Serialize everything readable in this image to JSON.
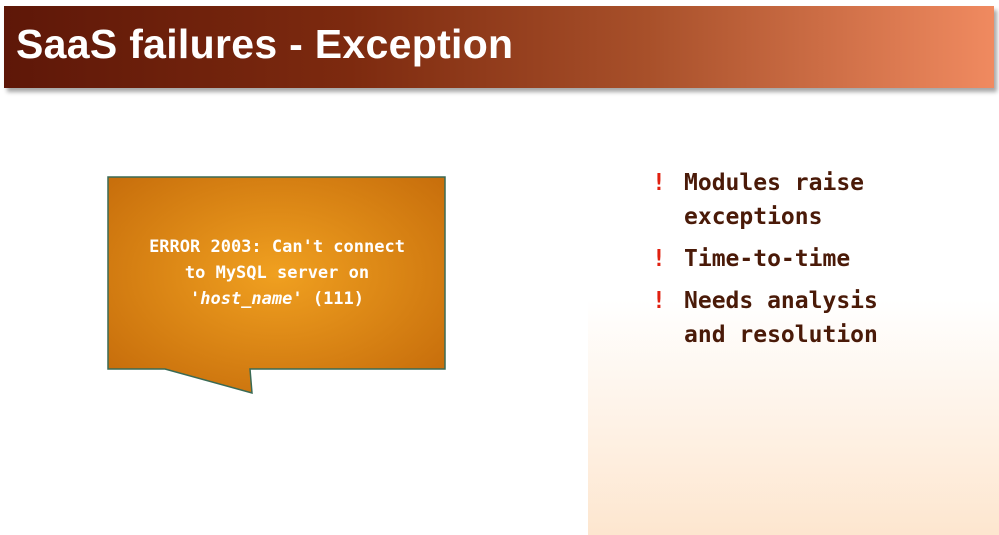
{
  "slide": {
    "title": "SaaS failures - Exception",
    "callout": {
      "line1": "ERROR 2003: Can't connect",
      "line2": "to MySQL server on",
      "line3_prefix": "'",
      "line3_host": "host_name",
      "line3_suffix": "' (111)"
    },
    "bullets": [
      {
        "mark": "!",
        "text": "Modules raise exceptions"
      },
      {
        "mark": "!",
        "text": "Time-to-time"
      },
      {
        "mark": "!",
        "text": "Needs analysis and resolution"
      }
    ]
  },
  "colors": {
    "title_dark": "#5e1708",
    "title_light": "#f08a60",
    "callout_fill": "#d88612",
    "callout_border": "#3a6a55",
    "bullet_mark": "#e02010",
    "bullet_text": "#4a1a08"
  }
}
